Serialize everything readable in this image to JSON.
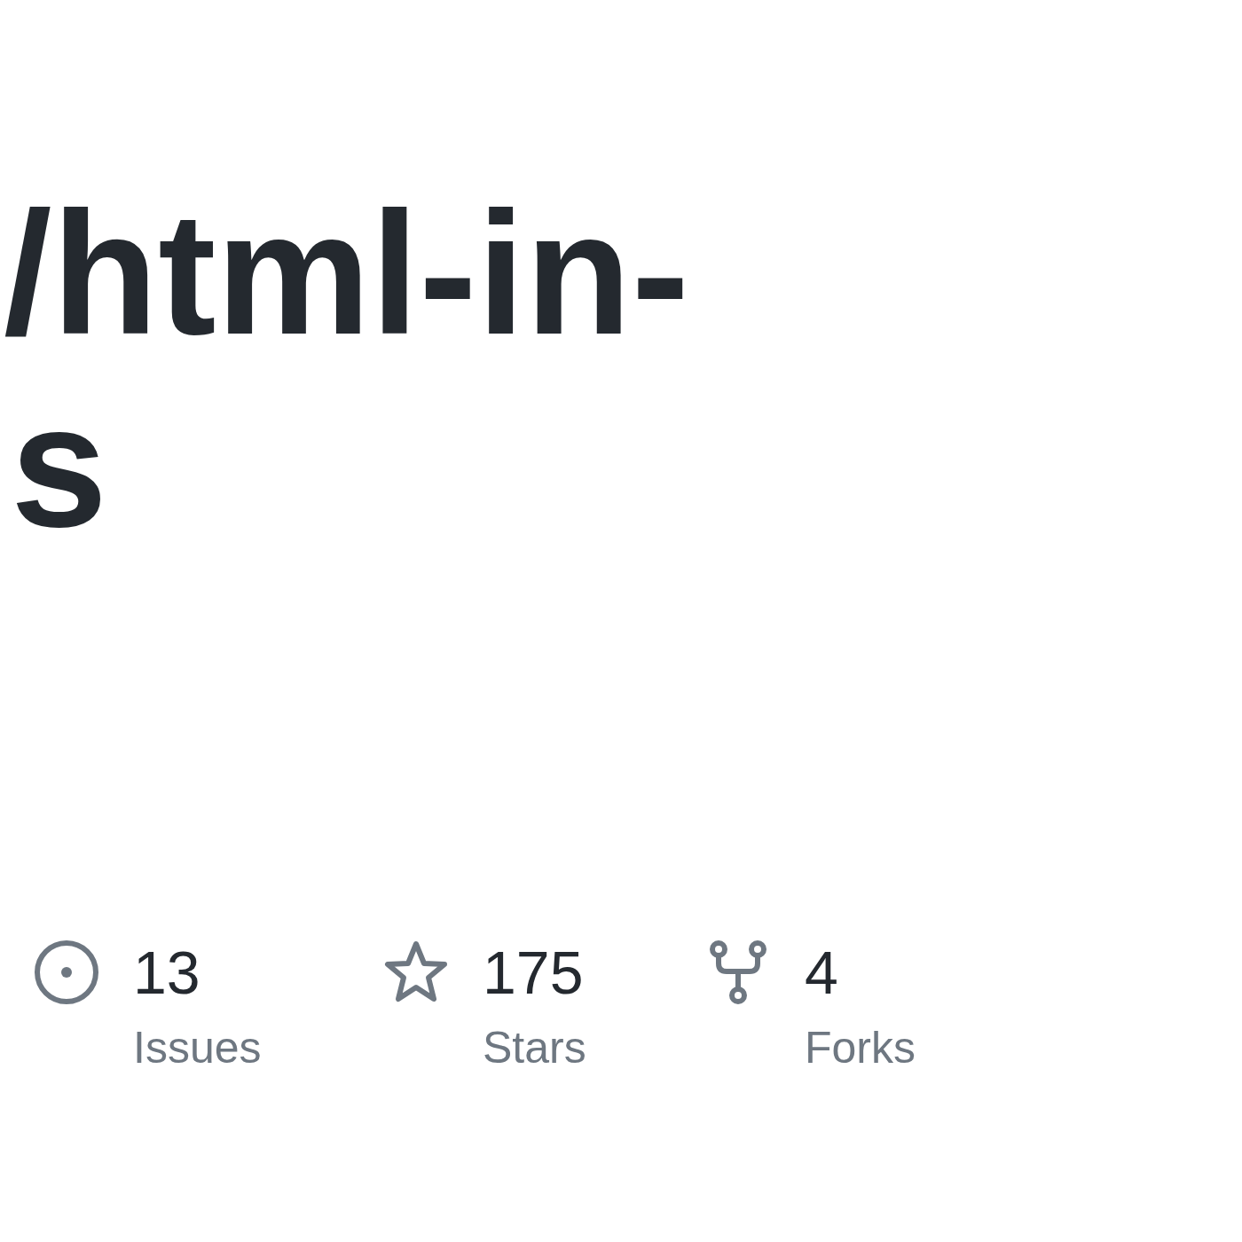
{
  "title": {
    "lines": [
      "/html-in-",
      "s"
    ]
  },
  "stats": [
    {
      "kind": "issues",
      "value": "13",
      "label": "Issues"
    },
    {
      "kind": "stars",
      "value": "175",
      "label": "Stars"
    },
    {
      "kind": "forks",
      "value": "4",
      "label": "Forks"
    }
  ]
}
